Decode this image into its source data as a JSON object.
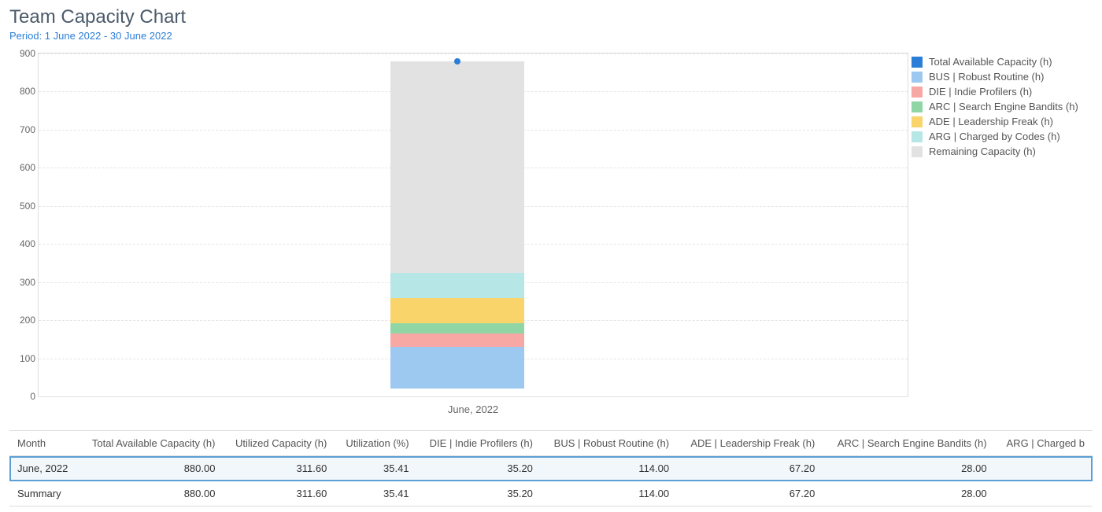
{
  "header": {
    "title": "Team Capacity Chart",
    "period_label": "Period: 1 June 2022 - 30 June 2022"
  },
  "colors": {
    "total": "#2a7ed8",
    "bus": "#9dc9f0",
    "die": "#f7a8a4",
    "arc": "#8fd6a4",
    "ade": "#f9d46b",
    "arg": "#b6e6e6",
    "remaining": "#e2e2e2"
  },
  "legend": [
    {
      "key": "total",
      "label": "Total Available Capacity (h)"
    },
    {
      "key": "bus",
      "label": "BUS | Robust Routine (h)"
    },
    {
      "key": "die",
      "label": "DIE | Indie Profilers (h)"
    },
    {
      "key": "arc",
      "label": "ARC | Search Engine Bandits (h)"
    },
    {
      "key": "ade",
      "label": "ADE | Leadership Freak (h)"
    },
    {
      "key": "arg",
      "label": "ARG | Charged by Codes (h)"
    },
    {
      "key": "remaining",
      "label": "Remaining Capacity (h)"
    }
  ],
  "chart_data": {
    "type": "bar",
    "title": "",
    "xlabel": "",
    "ylabel": "",
    "ylim": [
      0,
      900
    ],
    "yticks": [
      0,
      100,
      200,
      300,
      400,
      500,
      600,
      700,
      800,
      900
    ],
    "categories": [
      "June, 2022"
    ],
    "stack_order": [
      "bus",
      "die",
      "arc",
      "ade",
      "arg",
      "remaining"
    ],
    "series": [
      {
        "key": "bus",
        "name": "BUS | Robust Routine (h)",
        "values": [
          114.0
        ]
      },
      {
        "key": "die",
        "name": "DIE | Indie Profilers (h)",
        "values": [
          35.2
        ]
      },
      {
        "key": "arc",
        "name": "ARC | Search Engine Bandits (h)",
        "values": [
          28.0
        ]
      },
      {
        "key": "ade",
        "name": "ADE | Leadership Freak (h)",
        "values": [
          67.2
        ]
      },
      {
        "key": "arg",
        "name": "ARG | Charged by Codes (h)",
        "values": [
          67.2
        ]
      },
      {
        "key": "remaining",
        "name": "Remaining Capacity (h)",
        "values": [
          568.4
        ]
      }
    ],
    "marker_series": {
      "name": "Total Available Capacity (h)",
      "values": [
        880.0
      ]
    }
  },
  "table": {
    "columns": [
      "Month",
      "Total Available Capacity (h)",
      "Utilized Capacity (h)",
      "Utilization (%)",
      "DIE | Indie Profilers (h)",
      "BUS | Robust Routine (h)",
      "ADE | Leadership Freak (h)",
      "ARC | Search Engine Bandits (h)",
      "ARG | Charged b"
    ],
    "rows": [
      {
        "selected": true,
        "cells": [
          "June, 2022",
          "880.00",
          "311.60",
          "35.41",
          "35.20",
          "114.00",
          "67.20",
          "28.00",
          ""
        ]
      },
      {
        "selected": false,
        "cells": [
          "Summary",
          "880.00",
          "311.60",
          "35.41",
          "35.20",
          "114.00",
          "67.20",
          "28.00",
          ""
        ]
      }
    ]
  }
}
